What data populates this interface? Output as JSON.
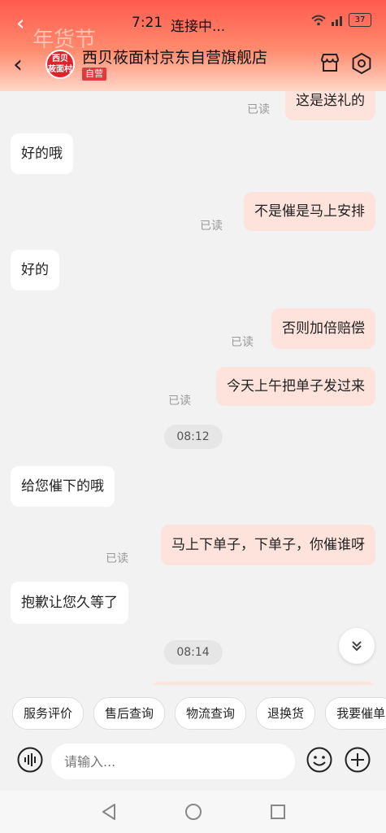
{
  "status": {
    "banner": "年货节",
    "time": "7:21",
    "title": "连接中...",
    "battery": "37"
  },
  "header": {
    "avatar_line1": "西贝",
    "avatar_line2": "莜面村",
    "shop_name": "西贝莜面村京东自营旗舰店",
    "badge": "自营"
  },
  "chat": {
    "read_label": "已读",
    "messages": [
      {
        "side": "out",
        "text": "这是送礼的"
      },
      {
        "side": "in",
        "text": "好的哦"
      },
      {
        "side": "out",
        "text": "不是催是马上安排"
      },
      {
        "side": "in",
        "text": "好的"
      },
      {
        "side": "out",
        "text": "否则加倍赔偿"
      },
      {
        "side": "out",
        "text": "今天上午把单子发过来"
      },
      {
        "side": "in",
        "text": "给您催下的哦"
      },
      {
        "side": "out",
        "text": "马上下单子，下单子，你催谁呀"
      },
      {
        "side": "in",
        "text": "抱歉让您久等了"
      }
    ],
    "timestamps": [
      "08:12",
      "08:14"
    ]
  },
  "quick_actions": [
    "服务评价",
    "售后查询",
    "物流查询",
    "退换货",
    "我要催单"
  ],
  "input": {
    "placeholder": "请输入..."
  },
  "colors": {
    "accent": "#e4393c",
    "out_bubble": "#fde3dc",
    "header_top": "#ff5a4e"
  }
}
